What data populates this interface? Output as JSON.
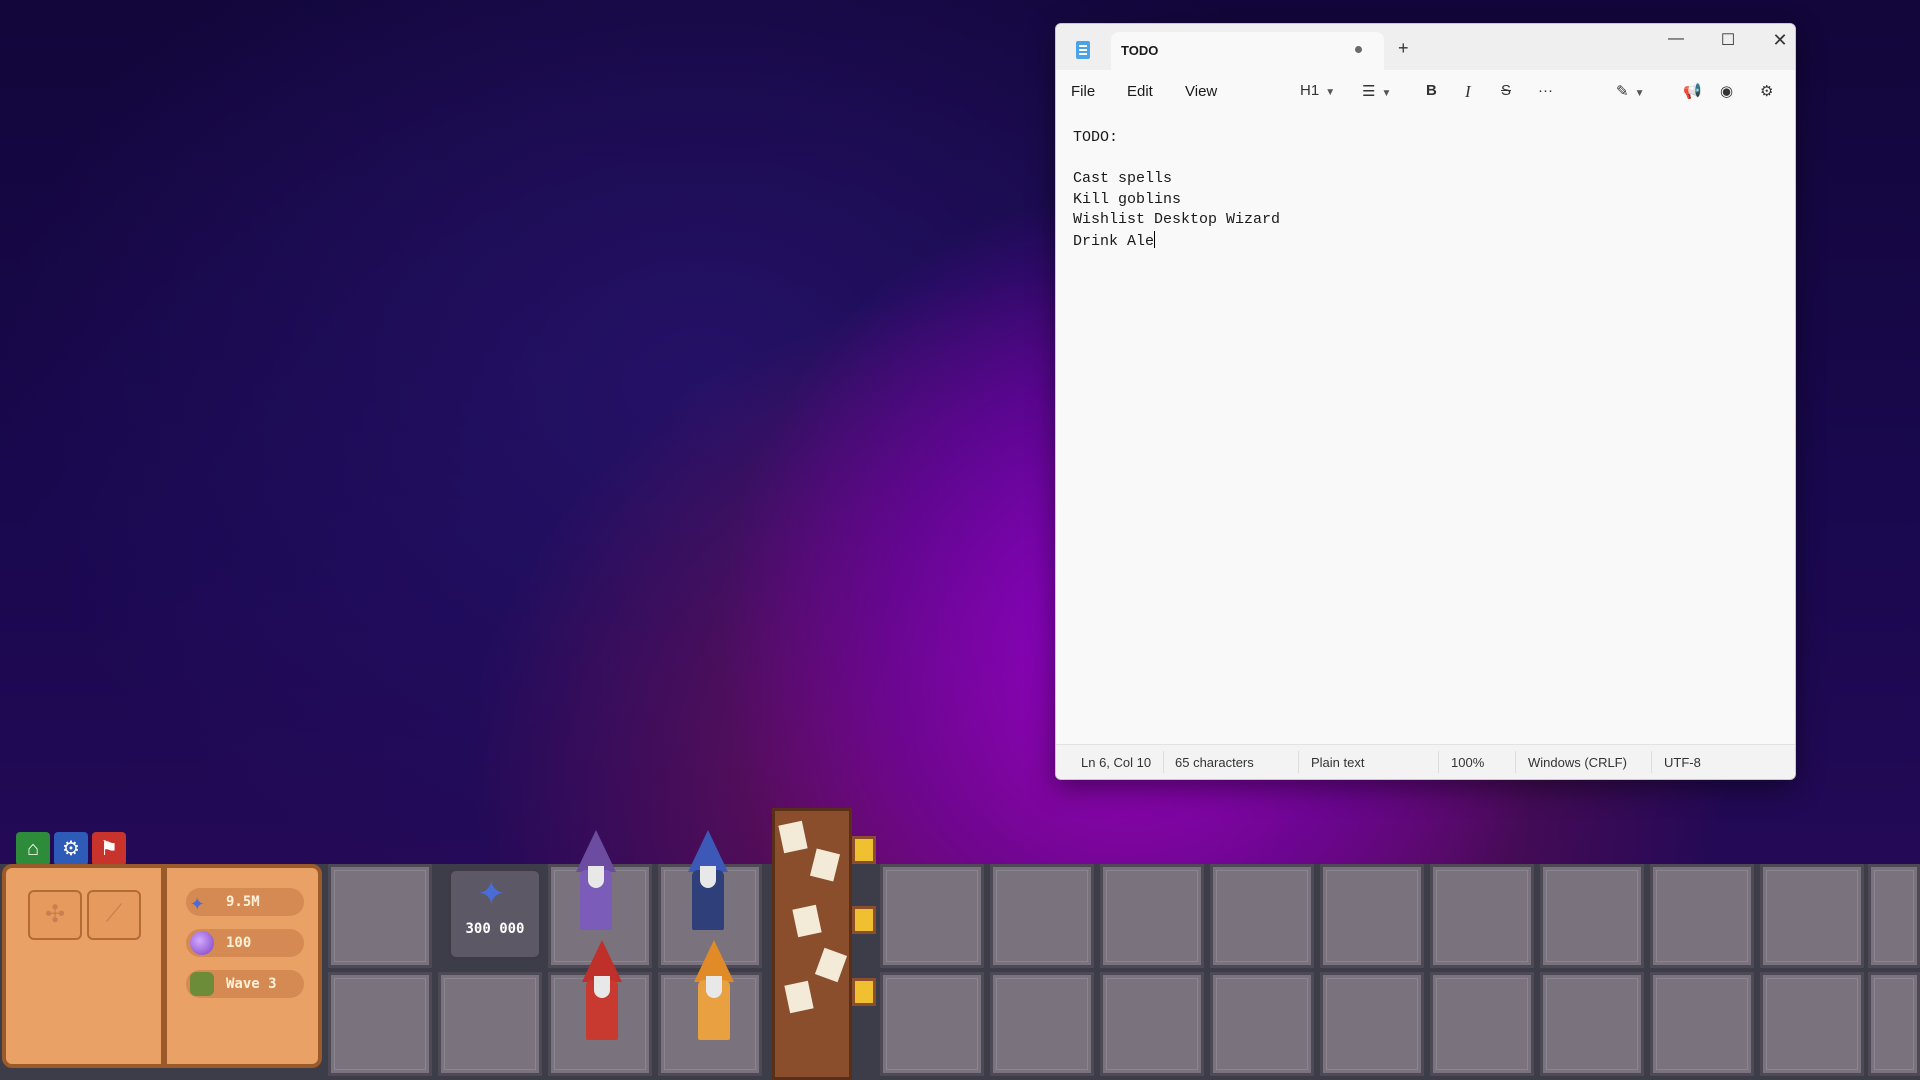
{
  "notepad": {
    "tab_title": "TODO",
    "new_tab": "+",
    "window_controls": {
      "minimize": "—",
      "maximize": "☐",
      "close": "✕"
    },
    "menu": {
      "file": "File",
      "edit": "Edit",
      "view": "View"
    },
    "toolbar": {
      "heading": "H1",
      "list": "☰",
      "bold": "B",
      "italic": "I",
      "strikethrough": "S",
      "more": "···",
      "copilot": "✎",
      "broadcast": "📢",
      "account": "◉",
      "settings": "⚙"
    },
    "lines": [
      "TODO:",
      "",
      "Cast spells",
      "Kill goblins",
      "Wishlist Desktop Wizard",
      "Drink Ale"
    ],
    "status": {
      "position": "Ln 6, Col 10",
      "characters": "65 characters",
      "format": "Plain text",
      "zoom": "100%",
      "line_ending": "Windows (CRLF)",
      "encoding": "UTF-8"
    }
  },
  "game": {
    "icons": {
      "home": "⌂",
      "settings": "⚙",
      "flag": "⚑"
    },
    "stats": {
      "mana": "9.5M",
      "gems": "100",
      "wave": "Wave 3"
    },
    "cost": "300 000",
    "colors": {
      "mana": "#4a6cd6",
      "gem": "#8a4fd0",
      "book": "#e9a166"
    }
  }
}
